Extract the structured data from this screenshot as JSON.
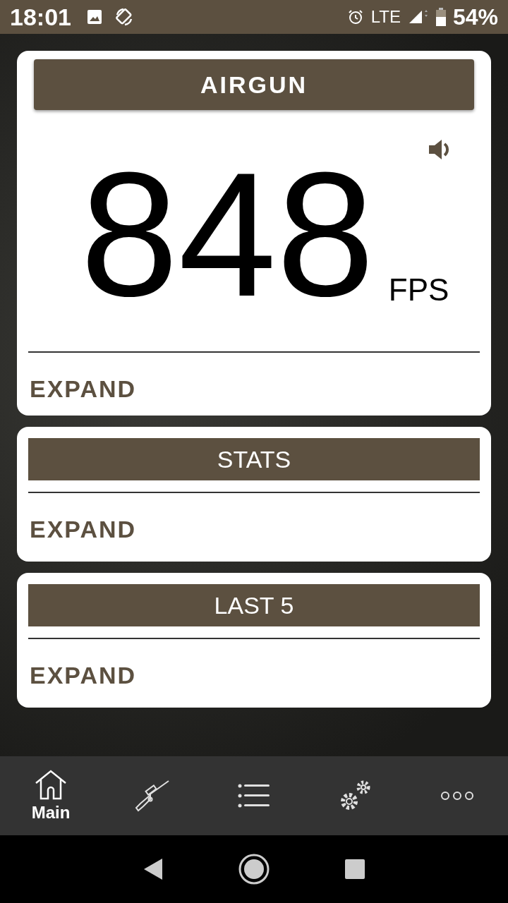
{
  "status_bar": {
    "time": "18:01",
    "network": "LTE",
    "battery": "54%"
  },
  "main_card": {
    "title": "AIRGUN",
    "reading": "848",
    "unit": "FPS",
    "expand": "EXPAND"
  },
  "sections": [
    {
      "title": "STATS",
      "expand": "EXPAND"
    },
    {
      "title": "LAST 5",
      "expand": "EXPAND"
    }
  ],
  "bottom_nav": [
    {
      "kind": "home",
      "label": "Main",
      "selected": true
    },
    {
      "kind": "rifle",
      "selected": false
    },
    {
      "kind": "list",
      "selected": false
    },
    {
      "kind": "settings",
      "selected": false
    },
    {
      "kind": "more",
      "selected": false
    }
  ]
}
